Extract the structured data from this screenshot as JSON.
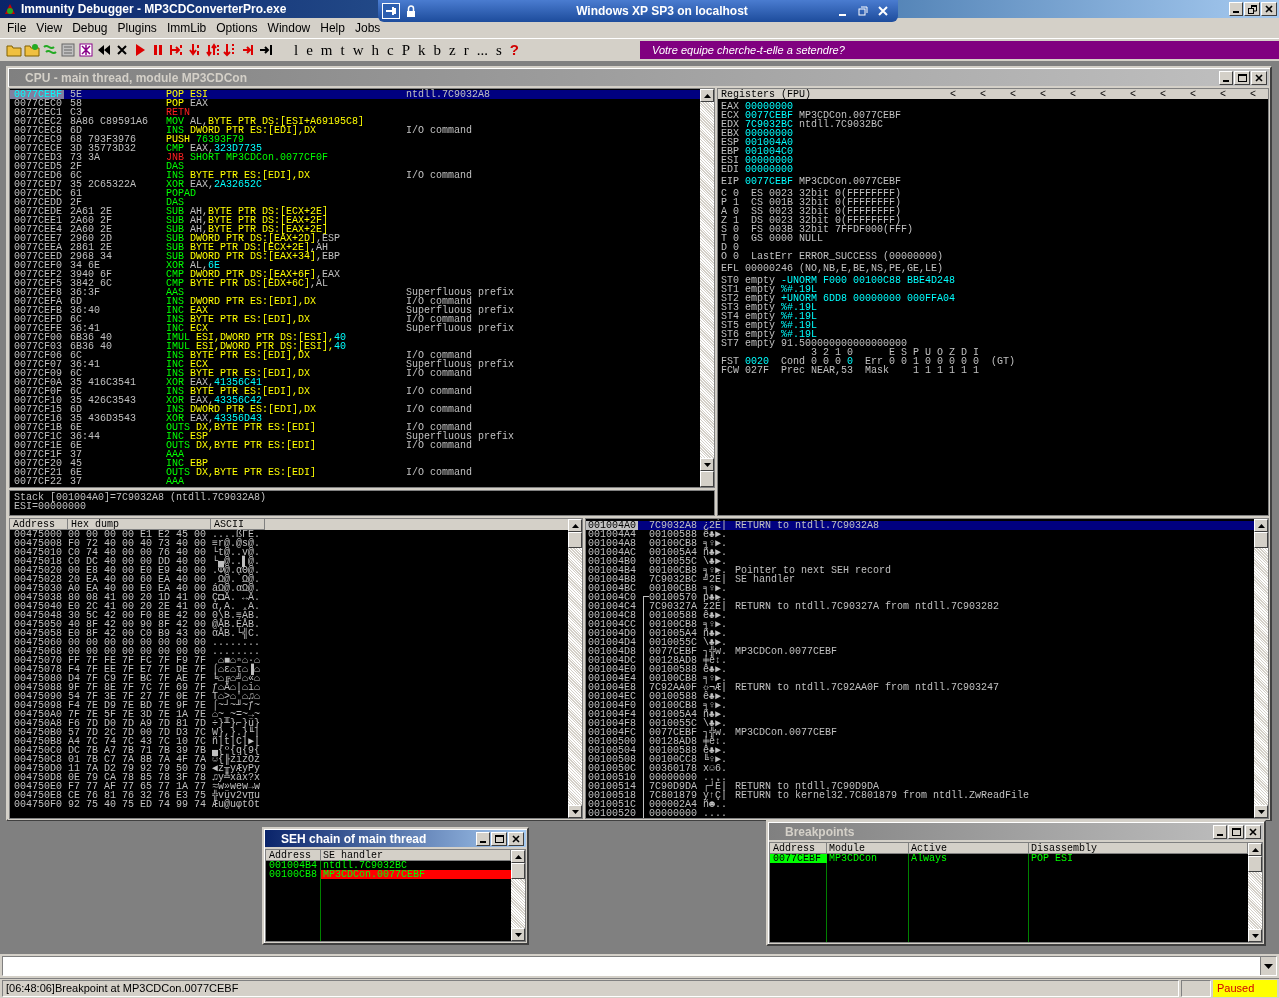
{
  "window": {
    "title": "Immunity Debugger - MP3CDConverterPro.exe"
  },
  "remote_bar": {
    "title": "Windows XP SP3 on localhost"
  },
  "menu": [
    "File",
    "View",
    "Debug",
    "Plugins",
    "ImmLib",
    "Options",
    "Window",
    "Help",
    "Jobs"
  ],
  "toolbar": {
    "letters": [
      {
        "label": "l",
        "kind": "letter"
      },
      {
        "label": "e",
        "kind": "letter"
      },
      {
        "label": "m",
        "kind": "letter"
      },
      {
        "label": "t",
        "kind": "letter"
      },
      {
        "label": "w",
        "kind": "letter"
      },
      {
        "label": "h",
        "kind": "letter"
      },
      {
        "label": "c",
        "kind": "letter"
      },
      {
        "label": "P",
        "kind": "letter"
      },
      {
        "label": "k",
        "kind": "letter"
      },
      {
        "label": "b",
        "kind": "letter"
      },
      {
        "label": "z",
        "kind": "letter"
      },
      {
        "label": "r",
        "kind": "letter"
      },
      {
        "label": "...",
        "kind": "letter"
      },
      {
        "label": "s",
        "kind": "letter"
      },
      {
        "label": "?",
        "kind": "help"
      }
    ],
    "banner": "Votre equipe cherche-t-elle a setendre?"
  },
  "cpu_window": {
    "title": "CPU - main thread, module MP3CDCon",
    "disassembly": [
      {
        "address": "0077CEBF",
        "hex": "5E",
        "mnemonic": "POP",
        "kind": "stack",
        "operands": [
          {
            "text": "ESI",
            "kind": "ref"
          }
        ],
        "comment": "ntdll.7C9032A8",
        "selected": true
      },
      {
        "address": "0077CEC0",
        "hex": "58",
        "mnemonic": "POP",
        "kind": "stack",
        "operands": [
          {
            "text": "EAX",
            "kind": "plain"
          }
        ],
        "selected": false
      },
      {
        "address": "0077CEC1",
        "hex": "C3",
        "mnemonic": "RETN",
        "kind": "jump",
        "selected": false
      },
      {
        "address": "0077CEC2",
        "hex": "8A86 C89591A6",
        "mnemonic": "MOV",
        "kind": "other",
        "operands": [
          {
            "text": "AL,",
            "kind": "plain"
          },
          {
            "text": "BYTE PTR DS:[ESI+A69195C8]",
            "kind": "ref"
          }
        ],
        "selected": false
      },
      {
        "address": "0077CEC8",
        "hex": "6D",
        "mnemonic": "INS",
        "kind": "other",
        "operands": [
          {
            "text": "DWORD PTR ES:[EDI],DX",
            "kind": "ref"
          }
        ],
        "comment": "I/O command",
        "selected": false
      },
      {
        "address": "0077CEC9",
        "hex": "68 793F3976",
        "mnemonic": "PUSH",
        "kind": "stack",
        "operands": [
          {
            "text": "76393F79",
            "kind": "target"
          }
        ],
        "selected": false
      },
      {
        "address": "0077CECE",
        "hex": "3D 35773D32",
        "mnemonic": "CMP",
        "kind": "other",
        "operands": [
          {
            "text": "EAX,",
            "kind": "plain"
          },
          {
            "text": "323D7735",
            "kind": "const"
          }
        ],
        "selected": false
      },
      {
        "address": "0077CED3",
        "hex": "73 3A",
        "mnemonic": "JNB",
        "kind": "jump",
        "operands": [
          {
            "text": "SHORT MP3CDCon.0077CF0F",
            "kind": "target"
          }
        ],
        "selected": false
      },
      {
        "address": "0077CED5",
        "hex": "2F",
        "mnemonic": "DAS",
        "kind": "other",
        "selected": false
      },
      {
        "address": "0077CED6",
        "hex": "6C",
        "mnemonic": "INS",
        "kind": "other",
        "operands": [
          {
            "text": "BYTE PTR ES:[EDI],DX",
            "kind": "ref"
          }
        ],
        "comment": "I/O command",
        "selected": false
      },
      {
        "address": "0077CED7",
        "hex": "35 2C65322A",
        "mnemonic": "XOR",
        "kind": "other",
        "operands": [
          {
            "text": "EAX,",
            "kind": "plain"
          },
          {
            "text": "2A32652C",
            "kind": "const"
          }
        ],
        "selected": false
      },
      {
        "address": "0077CEDC",
        "hex": "61",
        "mnemonic": "POPAD",
        "kind": "other",
        "selected": false
      },
      {
        "address": "0077CEDD",
        "hex": "2F",
        "mnemonic": "DAS",
        "kind": "other",
        "selected": false
      },
      {
        "address": "0077CEDE",
        "hex": "2A61 2E",
        "mnemonic": "SUB",
        "kind": "other",
        "operands": [
          {
            "text": "AH,",
            "kind": "plain"
          },
          {
            "text": "BYTE PTR DS:[ECX+2E]",
            "kind": "ref"
          }
        ],
        "selected": false
      },
      {
        "address": "0077CEE1",
        "hex": "2A60 2F",
        "mnemonic": "SUB",
        "kind": "other",
        "operands": [
          {
            "text": "AH,",
            "kind": "plain"
          },
          {
            "text": "BYTE PTR DS:[EAX+2F]",
            "kind": "ref"
          }
        ],
        "selected": false
      },
      {
        "address": "0077CEE4",
        "hex": "2A60 2E",
        "mnemonic": "SUB",
        "kind": "other",
        "operands": [
          {
            "text": "AH,",
            "kind": "plain"
          },
          {
            "text": "BYTE PTR DS:[EAX+2E]",
            "kind": "ref"
          }
        ],
        "selected": false
      },
      {
        "address": "0077CEE7",
        "hex": "2960 2D",
        "mnemonic": "SUB",
        "kind": "other",
        "operands": [
          {
            "text": "DWORD PTR DS:[EAX+2D]",
            "kind": "ref"
          },
          {
            "text": ",ESP",
            "kind": "plain"
          }
        ],
        "selected": false
      },
      {
        "address": "0077CEEA",
        "hex": "2861 2E",
        "mnemonic": "SUB",
        "kind": "other",
        "operands": [
          {
            "text": "BYTE PTR DS:[ECX+2E]",
            "kind": "ref"
          },
          {
            "text": ",AH",
            "kind": "plain"
          }
        ],
        "selected": false
      },
      {
        "address": "0077CEED",
        "hex": "2968 34",
        "mnemonic": "SUB",
        "kind": "other",
        "operands": [
          {
            "text": "DWORD PTR DS:[EAX+34]",
            "kind": "ref"
          },
          {
            "text": ",EBP",
            "kind": "plain"
          }
        ],
        "selected": false
      },
      {
        "address": "0077CEF0",
        "hex": "34 6E",
        "mnemonic": "XOR",
        "kind": "other",
        "operands": [
          {
            "text": "AL,",
            "kind": "plain"
          },
          {
            "text": "6E",
            "kind": "const"
          }
        ],
        "selected": false
      },
      {
        "address": "0077CEF2",
        "hex": "3940 6F",
        "mnemonic": "CMP",
        "kind": "other",
        "operands": [
          {
            "text": "DWORD PTR DS:[EAX+6F]",
            "kind": "ref"
          },
          {
            "text": ",EAX",
            "kind": "plain"
          }
        ],
        "selected": false
      },
      {
        "address": "0077CEF5",
        "hex": "3842 6C",
        "mnemonic": "CMP",
        "kind": "other",
        "operands": [
          {
            "text": "BYTE PTR DS:[EDX+6C]",
            "kind": "ref"
          },
          {
            "text": ",AL",
            "kind": "plain"
          }
        ],
        "selected": false
      },
      {
        "address": "0077CEF8",
        "hex": "36:3F",
        "mnemonic": "AAS",
        "kind": "other",
        "comment": "Superfluous prefix",
        "selected": false
      },
      {
        "address": "0077CEFA",
        "hex": "6D",
        "mnemonic": "INS",
        "kind": "other",
        "operands": [
          {
            "text": "DWORD PTR ES:[EDI],DX",
            "kind": "ref"
          }
        ],
        "comment": "I/O command",
        "selected": false
      },
      {
        "address": "0077CEFB",
        "hex": "36:40",
        "mnemonic": "INC",
        "kind": "other",
        "operands": [
          {
            "text": "EAX",
            "kind": "ref"
          }
        ],
        "comment": "Superfluous prefix",
        "selected": false
      },
      {
        "address": "0077CEFD",
        "hex": "6C",
        "mnemonic": "INS",
        "kind": "other",
        "operands": [
          {
            "text": "BYTE PTR ES:[EDI],DX",
            "kind": "ref"
          }
        ],
        "comment": "I/O command",
        "selected": false
      },
      {
        "address": "0077CEFE",
        "hex": "36:41",
        "mnemonic": "INC",
        "kind": "other",
        "operands": [
          {
            "text": "ECX",
            "kind": "ref"
          }
        ],
        "comment": "Superfluous prefix",
        "selected": false
      },
      {
        "address": "0077CF00",
        "hex": "6B36 40",
        "mnemonic": "IMUL",
        "kind": "other",
        "operands": [
          {
            "text": "ESI,DWORD PTR DS:[ESI],",
            "kind": "ref"
          },
          {
            "text": "40",
            "kind": "const"
          }
        ],
        "selected": false
      },
      {
        "address": "0077CF03",
        "hex": "6B36 40",
        "mnemonic": "IMUL",
        "kind": "other",
        "operands": [
          {
            "text": "ESI,DWORD PTR DS:[ESI],",
            "kind": "ref"
          },
          {
            "text": "40",
            "kind": "const"
          }
        ],
        "selected": false
      },
      {
        "address": "0077CF06",
        "hex": "6C",
        "mnemonic": "INS",
        "kind": "other",
        "operands": [
          {
            "text": "BYTE PTR ES:[EDI],DX",
            "kind": "ref"
          }
        ],
        "comment": "I/O command",
        "selected": false
      },
      {
        "address": "0077CF07",
        "hex": "36:41",
        "mnemonic": "INC",
        "kind": "other",
        "operands": [
          {
            "text": "ECX",
            "kind": "ref"
          }
        ],
        "comment": "Superfluous prefix",
        "selected": false
      },
      {
        "address": "0077CF09",
        "hex": "6C",
        "mnemonic": "INS",
        "kind": "other",
        "operands": [
          {
            "text": "BYTE PTR ES:[EDI],DX",
            "kind": "ref"
          }
        ],
        "comment": "I/O command",
        "selected": false
      },
      {
        "address": "0077CF0A",
        "hex": "35 416C3541",
        "mnemonic": "XOR",
        "kind": "other",
        "operands": [
          {
            "text": "EAX,",
            "kind": "plain"
          },
          {
            "text": "41356C41",
            "kind": "const"
          }
        ],
        "selected": false
      },
      {
        "address": "0077CF0F",
        "hex": "6C",
        "mnemonic": "INS",
        "kind": "other",
        "operands": [
          {
            "text": "BYTE PTR ES:[EDI],DX",
            "kind": "ref"
          }
        ],
        "comment": "I/O command",
        "selected": false
      },
      {
        "address": "0077CF10",
        "hex": "35 426C3543",
        "mnemonic": "XOR",
        "kind": "other",
        "operands": [
          {
            "text": "EAX,",
            "kind": "plain"
          },
          {
            "text": "43356C42",
            "kind": "const"
          }
        ],
        "selected": false
      },
      {
        "address": "0077CF15",
        "hex": "6D",
        "mnemonic": "INS",
        "kind": "other",
        "operands": [
          {
            "text": "DWORD PTR ES:[EDI],DX",
            "kind": "ref"
          }
        ],
        "comment": "I/O command",
        "selected": false
      },
      {
        "address": "0077CF16",
        "hex": "35 436D3543",
        "mnemonic": "XOR",
        "kind": "other",
        "operands": [
          {
            "text": "EAX,",
            "kind": "plain"
          },
          {
            "text": "43356D43",
            "kind": "const"
          }
        ],
        "selected": false
      },
      {
        "address": "0077CF1B",
        "hex": "6E",
        "mnemonic": "OUTS",
        "kind": "other",
        "operands": [
          {
            "text": "DX,BYTE PTR ES:[EDI]",
            "kind": "ref"
          }
        ],
        "comment": "I/O command",
        "selected": false
      },
      {
        "address": "0077CF1C",
        "hex": "36:44",
        "mnemonic": "INC",
        "kind": "other",
        "operands": [
          {
            "text": "ESP",
            "kind": "ref"
          }
        ],
        "comment": "Superfluous prefix",
        "selected": false
      },
      {
        "address": "0077CF1E",
        "hex": "6E",
        "mnemonic": "OUTS",
        "kind": "other",
        "operands": [
          {
            "text": "DX,BYTE PTR ES:[EDI]",
            "kind": "ref"
          }
        ],
        "comment": "I/O command",
        "selected": false
      },
      {
        "address": "0077CF1F",
        "hex": "37",
        "mnemonic": "AAA",
        "kind": "other",
        "selected": false
      },
      {
        "address": "0077CF20",
        "hex": "45",
        "mnemonic": "INC",
        "kind": "other",
        "operands": [
          {
            "text": "EBP",
            "kind": "ref"
          }
        ],
        "selected": false
      },
      {
        "address": "0077CF21",
        "hex": "6E",
        "mnemonic": "OUTS",
        "kind": "other",
        "operands": [
          {
            "text": "DX,BYTE PTR ES:[EDI]",
            "kind": "ref"
          }
        ],
        "comment": "I/O command",
        "selected": false
      },
      {
        "address": "0077CF22",
        "hex": "37",
        "mnemonic": "AAA",
        "kind": "other",
        "selected": false
      }
    ],
    "info": [
      "Stack [001004A0]=7C9032A8 (ntdll.7C9032A8)",
      "ESI=00000000"
    ],
    "registers": {
      "title": "Registers (FPU)",
      "arrows": [
        "<",
        "<",
        "<",
        "<",
        "<",
        "<",
        "<",
        "<",
        "<",
        "<",
        "<"
      ],
      "groups": [
        [
          [
            {
              "text": "EAX ",
              "kind": "plain"
            },
            {
              "text": "00000000",
              "kind": "value"
            }
          ],
          [
            {
              "text": "ECX ",
              "kind": "plain"
            },
            {
              "text": "0077CEBF",
              "kind": "value"
            },
            {
              "text": " MP3CDCon.0077CEBF",
              "kind": "plain"
            }
          ],
          [
            {
              "text": "EDX ",
              "kind": "plain"
            },
            {
              "text": "7C9032BC",
              "kind": "value"
            },
            {
              "text": " ntdll.7C9032BC",
              "kind": "plain"
            }
          ],
          [
            {
              "text": "EBX ",
              "kind": "plain"
            },
            {
              "text": "00000000",
              "kind": "value"
            }
          ],
          [
            {
              "text": "ESP ",
              "kind": "plain"
            },
            {
              "text": "001004A0",
              "kind": "value"
            }
          ],
          [
            {
              "text": "EBP ",
              "kind": "plain"
            },
            {
              "text": "001004C0",
              "kind": "value"
            }
          ],
          [
            {
              "text": "ESI ",
              "kind": "plain"
            },
            {
              "text": "00000000",
              "kind": "value"
            }
          ],
          [
            {
              "text": "EDI ",
              "kind": "plain"
            },
            {
              "text": "00000000",
              "kind": "value"
            }
          ]
        ],
        [
          [
            {
              "text": "EIP ",
              "kind": "plain"
            },
            {
              "text": "0077CEBF",
              "kind": "value"
            },
            {
              "text": " MP3CDCon.0077CEBF",
              "kind": "plain"
            }
          ]
        ],
        [
          [
            {
              "text": "C 0  ES 0023 32bit 0(FFFFFFFF)",
              "kind": "plain"
            }
          ],
          [
            {
              "text": "P 1  CS 001B 32bit 0(FFFFFFFF)",
              "kind": "plain"
            }
          ],
          [
            {
              "text": "A 0  SS 0023 32bit 0(FFFFFFFF)",
              "kind": "plain"
            }
          ],
          [
            {
              "text": "Z 1  DS 0023 32bit 0(FFFFFFFF)",
              "kind": "plain"
            }
          ],
          [
            {
              "text": "S 0  FS 003B 32bit 7FFDF000(FFF)",
              "kind": "plain"
            }
          ],
          [
            {
              "text": "T 0  GS 0000 NULL",
              "kind": "plain"
            }
          ],
          [
            {
              "text": "D 0",
              "kind": "plain"
            }
          ],
          [
            {
              "text": "O 0  LastErr ERROR_SUCCESS (00000000)",
              "kind": "plain"
            }
          ]
        ],
        [
          [
            {
              "text": "EFL 00000246 (NO,NB,E,BE,NS,PE,GE,LE)",
              "kind": "plain"
            }
          ]
        ],
        [
          [
            {
              "text": "ST0 empty ",
              "kind": "plain"
            },
            {
              "text": "-UNORM F000 00100C88 BBE4D248",
              "kind": "value"
            }
          ],
          [
            {
              "text": "ST1 empty ",
              "kind": "plain"
            },
            {
              "text": "%#.19L",
              "kind": "value"
            }
          ],
          [
            {
              "text": "ST2 empty ",
              "kind": "plain"
            },
            {
              "text": "+UNORM 6DD8 00000000 000FFA04",
              "kind": "value"
            }
          ],
          [
            {
              "text": "ST3 empty ",
              "kind": "plain"
            },
            {
              "text": "%#.19L",
              "kind": "value"
            }
          ],
          [
            {
              "text": "ST4 empty ",
              "kind": "plain"
            },
            {
              "text": "%#.19L",
              "kind": "value"
            }
          ],
          [
            {
              "text": "ST5 empty ",
              "kind": "plain"
            },
            {
              "text": "%#.19L",
              "kind": "value"
            }
          ],
          [
            {
              "text": "ST6 empty ",
              "kind": "plain"
            },
            {
              "text": "%#.19L",
              "kind": "value"
            }
          ],
          [
            {
              "text": "ST7 empty 91.500000000000000000",
              "kind": "plain"
            }
          ],
          [
            {
              "text": "               3 2 1 0      E S P U O Z D I",
              "kind": "plain"
            }
          ],
          [
            {
              "text": "FST ",
              "kind": "plain"
            },
            {
              "text": "0020",
              "kind": "value"
            },
            {
              "text": "  Cond 0 0 0 ",
              "kind": "plain"
            },
            {
              "text": "0",
              "kind": "value"
            },
            {
              "text": "  Err 0 0 1 0 0 0 0 0  (GT)",
              "kind": "plain"
            }
          ],
          [
            {
              "text": "FCW 027F  Prec NEAR,53  Mask    1 1 1 1 1 1",
              "kind": "plain"
            }
          ]
        ]
      ]
    },
    "dump": {
      "columns": [
        "Address",
        "Hex dump",
        "ASCII"
      ],
      "rows": [
        {
          "address": "00475000",
          "hex": "00 00 00 00 E1 E2 45 00",
          "ascii": "....ßΓE."
        },
        {
          "address": "00475008",
          "hex": "F0 72 40 00 40 73 40 00",
          "ascii": "≡r@.@s@."
        },
        {
          "address": "00475010",
          "hex": "C0 74 40 00 00 76 40 00",
          "ascii": "└t@..v@."
        },
        {
          "address": "00475018",
          "hex": "C0 DC 40 00 00 DD 40 00",
          "ascii": "└▄@..▌@."
        },
        {
          "address": "00475020",
          "hex": "00 E8 40 00 E0 E9 40 00",
          "ascii": ".Φ@.αΘ@."
        },
        {
          "address": "00475028",
          "hex": "20 EA 40 00 60 EA 40 00",
          "ascii": " Ω@.`Ω@."
        },
        {
          "address": "00475030",
          "hex": "A0 EA 40 00 E0 EA 40 00",
          "ascii": "áΩ@.αΩ@."
        },
        {
          "address": "00475038",
          "hex": "80 08 41 00 20 1D 41 00",
          "ascii": "Ç◘A. ↔A."
        },
        {
          "address": "00475040",
          "hex": "E0 2C 41 00 20 2E 41 00",
          "ascii": "α,A. .A."
        },
        {
          "address": "00475048",
          "hex": "30 5C 42 00 F0 8E 42 00",
          "ascii": "0\\B.≡ÄB."
        },
        {
          "address": "00475050",
          "hex": "40 8F 42 00 90 8F 42 00",
          "ascii": "@ÅB.ÉÅB."
        },
        {
          "address": "00475058",
          "hex": "E0 8F 42 00 C0 B9 43 00",
          "ascii": "αÅB.└╣C."
        },
        {
          "address": "00475060",
          "hex": "00 00 00 00 00 00 00 00",
          "ascii": "........"
        },
        {
          "address": "00475068",
          "hex": "00 00 00 00 00 00 00 00",
          "ascii": "........"
        },
        {
          "address": "00475070",
          "hex": "FF 7F FE 7F FC 7F F9 7F",
          "ascii": " ⌂■⌂ⁿ⌂·⌂"
        },
        {
          "address": "00475078",
          "hex": "F4 7F EE 7F E7 7F DE 7F",
          "ascii": "⌠⌂ε⌂τ⌂▐⌂"
        },
        {
          "address": "00475080",
          "hex": "D4 7F C9 7F BC 7F AE 7F",
          "ascii": "╘⌂╔⌂╝⌂«⌂"
        },
        {
          "address": "00475088",
          "hex": "9F 7F 8E 7F 7C 7F 69 7F",
          "ascii": "ƒ⌂Ä⌂|⌂i⌂"
        },
        {
          "address": "00475090",
          "hex": "54 7F 3E 7F 27 7F 0E 7F",
          "ascii": "T⌂>⌂'⌂♫⌂"
        },
        {
          "address": "00475098",
          "hex": "F4 7E D9 7E BD 7E 9F 7E",
          "ascii": "⌠~┘~╜~ƒ~"
        },
        {
          "address": "004750A0",
          "hex": "7F 7E 5F 7E 3D 7E 1A 7E",
          "ascii": "⌂~_~=~→~"
        },
        {
          "address": "004750A8",
          "hex": "F6 7D D0 7D A9 7D 81 7D",
          "ascii": "÷}╨}⌐}ü}"
        },
        {
          "address": "004750B0",
          "hex": "57 7D 2C 7D 00 7D D3 7C",
          "ascii": "W},}.}╙|"
        },
        {
          "address": "004750B8",
          "hex": "A4 7C 74 7C 43 7C 10 7C",
          "ascii": "ñ|t|C|►|"
        },
        {
          "address": "004750C0",
          "hex": "DC 7B A7 7B 71 7B 39 7B",
          "ascii": "▄{º{q{9{"
        },
        {
          "address": "004750C8",
          "hex": "01 7B C7 7A 8B 7A 4F 7A",
          "ascii": "☺{╟zïzOz"
        },
        {
          "address": "004750D0",
          "hex": "11 7A D2 79 92 79 50 79",
          "ascii": "◄z╥yÆyPy"
        },
        {
          "address": "004750D8",
          "hex": "0E 79 CA 78 85 78 3F 78",
          "ascii": "♫y╩xàx?x"
        },
        {
          "address": "004750E0",
          "hex": "F7 77 AF 77 65 77 1A 77",
          "ascii": "≈w»wew→w"
        },
        {
          "address": "004750E8",
          "hex": "CE 76 81 76 32 76 E3 75",
          "ascii": "╬vüv2vπu"
        },
        {
          "address": "004750F0",
          "hex": "92 75 40 75 ED 74 99 74",
          "ascii": "Æu@uφtÖt"
        }
      ]
    },
    "stack": {
      "rows": [
        {
          "address": "001004A0",
          "value": "7C9032A8",
          "ascii": "¿2É|",
          "comment": "RETURN to ntdll.7C9032A8",
          "selected": true,
          "framed": false
        },
        {
          "address": "001004A4",
          "value": "00100588",
          "ascii": "ê♣►.",
          "selected": false,
          "framed": false
        },
        {
          "address": "001004A8",
          "value": "00100CB8",
          "ascii": "╕♀►.",
          "selected": false,
          "framed": false
        },
        {
          "address": "001004AC",
          "value": "001005A4",
          "ascii": "ñ♣►.",
          "selected": false,
          "framed": false
        },
        {
          "address": "001004B0",
          "value": "0010055C",
          "ascii": "\\♣►.",
          "selected": false,
          "framed": false
        },
        {
          "address": "001004B4",
          "value": "00100CB8",
          "ascii": "╕♀►.",
          "comment": "Pointer to next SEH record",
          "selected": false,
          "framed": false
        },
        {
          "address": "001004B8",
          "value": "7C9032BC",
          "ascii": "╝2É|",
          "comment": "SE handler",
          "selected": false,
          "framed": false
        },
        {
          "address": "001004BC",
          "value": "00100CB8",
          "ascii": "╕♀►.",
          "selected": false,
          "framed": false
        },
        {
          "address": "001004C0",
          "value": "00100570",
          "ascii": "p♣►.",
          "selected": false,
          "framed": true
        },
        {
          "address": "001004C4",
          "value": "7C90327A",
          "ascii": "z2É|",
          "comment": "RETURN to ntdll.7C90327A from ntdll.7C903282",
          "selected": false,
          "framed": true
        },
        {
          "address": "001004C8",
          "value": "00100588",
          "ascii": "ê♣►.",
          "selected": false,
          "framed": true
        },
        {
          "address": "001004CC",
          "value": "00100CB8",
          "ascii": "╕♀►.",
          "selected": false,
          "framed": true
        },
        {
          "address": "001004D0",
          "value": "001005A4",
          "ascii": "ñ♣►.",
          "selected": false,
          "framed": true
        },
        {
          "address": "001004D4",
          "value": "0010055C",
          "ascii": "\\♣►.",
          "selected": false,
          "framed": true
        },
        {
          "address": "001004D8",
          "value": "0077CEBF",
          "ascii": "┐╬w.",
          "comment": "MP3CDCon.0077CEBF",
          "selected": false,
          "framed": true
        },
        {
          "address": "001004DC",
          "value": "00128AD8",
          "ascii": "╪è↕.",
          "selected": false,
          "framed": true
        },
        {
          "address": "001004E0",
          "value": "00100588",
          "ascii": "ê♣►.",
          "selected": false,
          "framed": true
        },
        {
          "address": "001004E4",
          "value": "00100CB8",
          "ascii": "╕♀►.",
          "selected": false,
          "framed": true
        },
        {
          "address": "001004E8",
          "value": "7C92AA0F",
          "ascii": "☼¬Æ|",
          "comment": "RETURN to ntdll.7C92AA0F from ntdll.7C903247",
          "selected": false,
          "framed": true
        },
        {
          "address": "001004EC",
          "value": "00100588",
          "ascii": "ê♣►.",
          "selected": false,
          "framed": true
        },
        {
          "address": "001004F0",
          "value": "00100CB8",
          "ascii": "╕♀►.",
          "selected": false,
          "framed": true
        },
        {
          "address": "001004F4",
          "value": "001005A4",
          "ascii": "ñ♣►.",
          "selected": false,
          "framed": true
        },
        {
          "address": "001004F8",
          "value": "0010055C",
          "ascii": "\\♣►.",
          "selected": false,
          "framed": true
        },
        {
          "address": "001004FC",
          "value": "0077CEBF",
          "ascii": "┐╬w.",
          "comment": "MP3CDCon.0077CEBF",
          "selected": false,
          "framed": true
        },
        {
          "address": "00100500",
          "value": "00128AD8",
          "ascii": "╪è↕.",
          "selected": false,
          "framed": true
        },
        {
          "address": "00100504",
          "value": "00100588",
          "ascii": "ê♣►.",
          "selected": false,
          "framed": true
        },
        {
          "address": "00100508",
          "value": "00100CC8",
          "ascii": "╚♀►.",
          "selected": false,
          "framed": true
        },
        {
          "address": "0010050C",
          "value": "00360178",
          "ascii": "x☺6.",
          "selected": false,
          "framed": true
        },
        {
          "address": "00100510",
          "value": "00000000",
          "ascii": "....",
          "selected": false,
          "framed": true
        },
        {
          "address": "00100514",
          "value": "7C90D9DA",
          "ascii": "┌┘É|",
          "comment": "RETURN to ntdll.7C90D9DA",
          "selected": false,
          "framed": true
        },
        {
          "address": "00100518",
          "value": "7C801879",
          "ascii": "y↑Ç|",
          "comment": "RETURN to kernel32.7C801879 from ntdll.ZwReadFile",
          "selected": false,
          "framed": true
        },
        {
          "address": "0010051C",
          "value": "000002A4",
          "ascii": "ñ☻..",
          "selected": false,
          "framed": true
        },
        {
          "address": "00100520",
          "value": "00000000",
          "ascii": "....",
          "selected": false,
          "framed": true
        }
      ]
    }
  },
  "seh_window": {
    "title": "SEH chain of main thread",
    "columns": [
      "Address",
      "SE handler"
    ],
    "rows": [
      {
        "address": "001004B4",
        "handler": "ntdll.7C9032BC",
        "highlighted": false
      },
      {
        "address": "00100CB8",
        "handler": "MP3CDCon.0077CEBF",
        "highlighted": true
      }
    ]
  },
  "breakpoints_window": {
    "title": "Breakpoints",
    "columns": [
      "Address",
      "Module",
      "Active",
      "Disassembly"
    ],
    "rows": [
      {
        "address": "0077CEBF",
        "module": "MP3CDCon",
        "active": "Always",
        "disassembly": "POP ESI",
        "selected": true
      }
    ]
  },
  "status_bar": {
    "message": "[06:48:06]Breakpoint at MP3CDCon.0077CEBF",
    "state": "Paused"
  }
}
